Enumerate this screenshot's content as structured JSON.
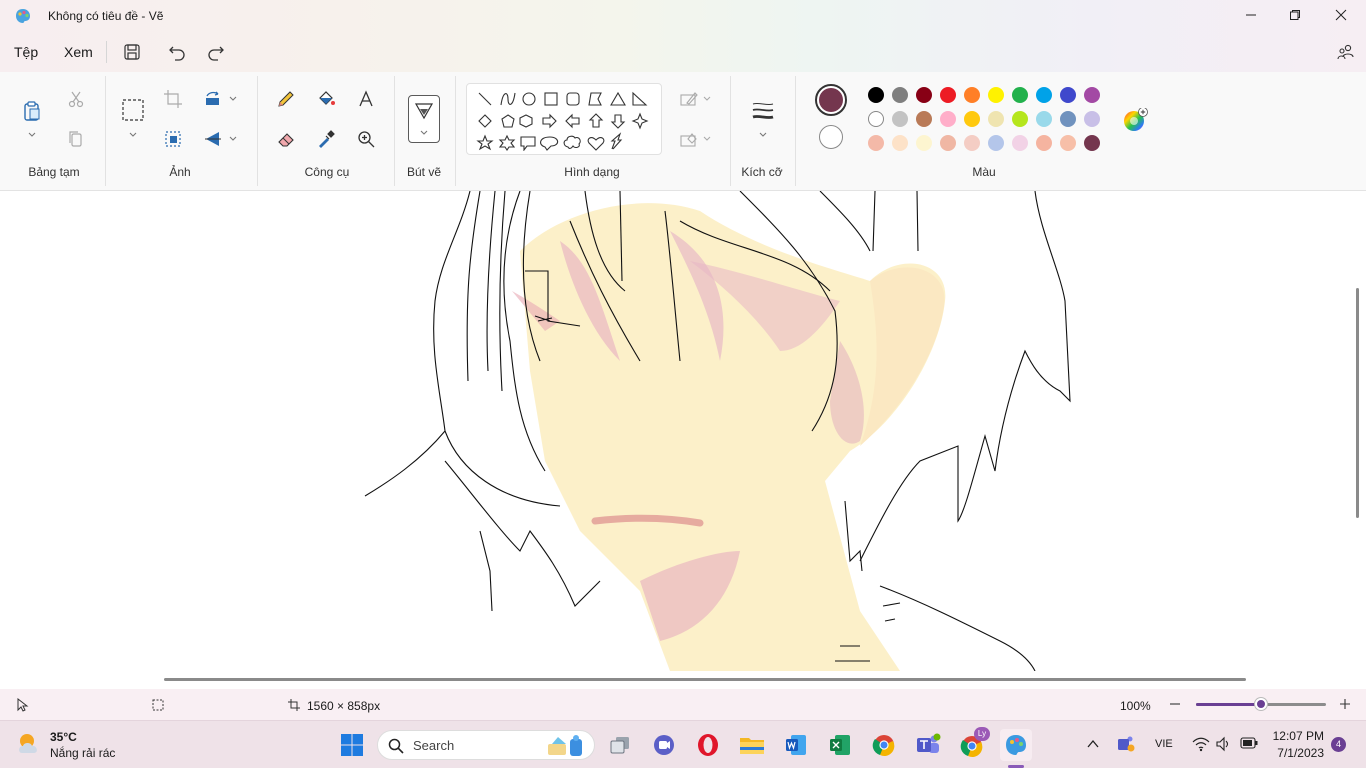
{
  "window": {
    "title": "Không có tiêu đề - Vẽ"
  },
  "menu": {
    "file": "Tệp",
    "view": "Xem"
  },
  "ribbon": {
    "groups": {
      "clipboard": "Bảng tạm",
      "image": "Ảnh",
      "tools": "Công cụ",
      "brushes": "Bút vẽ",
      "shapes": "Hình dạng",
      "size": "Kích cỡ",
      "colors": "Màu"
    },
    "primary_color": "#74364e",
    "secondary_color": "#ffffff",
    "palette": [
      [
        "#000000",
        "#7f7f7f",
        "#880015",
        "#ed1c24",
        "#ff7f27",
        "#fff200",
        "#22b14c",
        "#00a2e8",
        "#3f48cc",
        "#a349a4"
      ],
      [
        "#ffffff",
        "#c3c3c3",
        "#b97a57",
        "#ffaec9",
        "#ffc90e",
        "#efe4b0",
        "#b5e61d",
        "#99d9ea",
        "#7092be",
        "#c8bfe7"
      ],
      [
        "#f4b9a8",
        "#fde2c8",
        "#fdf5d0",
        "#f0b7a4",
        "#f4cdc4",
        "#b4c6ea",
        "#f2d2e6",
        "#f5b4a0",
        "#f7bfa8",
        "#74364e"
      ]
    ]
  },
  "status": {
    "canvas_size": "1560 × 858px",
    "zoom": "100%",
    "zoom_level": 0.5
  },
  "taskbar": {
    "weather_temp": "35°C",
    "weather_desc": "Nắng rải rác",
    "search_placeholder": "Search",
    "language": "VIE",
    "time": "12:07 PM",
    "date": "7/1/2023",
    "notifications": "4",
    "chrome_badge": "Ly"
  }
}
